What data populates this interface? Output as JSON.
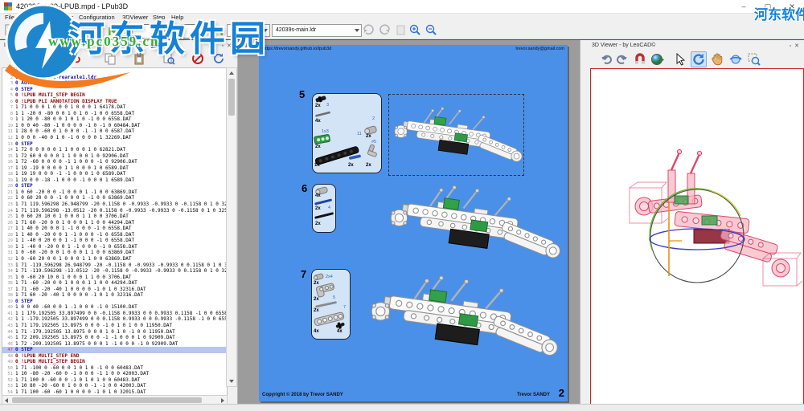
{
  "window": {
    "title": "42039S-1-09-LPUB.mpd - LPub3D",
    "minimize": "–",
    "maximize": "▢",
    "close": "✕"
  },
  "menu": {
    "items": [
      "File",
      "Edit",
      "View",
      "Tools",
      "Configuration",
      "3DViewer",
      "Step",
      "Help"
    ]
  },
  "toolbar": {
    "page_input_value": "3 of 224",
    "page_combo_value": "Page 2",
    "model_combo_value": "42039s-main.ldr"
  },
  "watermark": {
    "site_name": "河东软件园",
    "site_url": "www.pc0359.cn",
    "site_name_corner": "河东软件园"
  },
  "editor": {
    "title": "LDraw File Editor",
    "current_line": 47,
    "lines": [
      [
        1,
        "c",
        "0 rear axle"
      ],
      [
        2,
        "m",
        "0 Name: 42039s-rearaxle1.ldr"
      ],
      [
        3,
        "m",
        "0 Author: Trevor SANDY"
      ],
      [
        4,
        "s",
        "0 STEP"
      ],
      [
        5,
        "l",
        "0 !LPUB MULTI_STEP BEGIN"
      ],
      [
        6,
        "l",
        "0 !LPUB PLI ANNOTATION DISPLAY TRUE"
      ],
      [
        7,
        "p",
        "1 71 0 0 0 1 0 0 0 1 0 0 0 1 64178.DAT"
      ],
      [
        8,
        "p",
        "1 1 -20 0 -80 0 0 1 0 1 0 -1 0 0 6558.DAT"
      ],
      [
        9,
        "p",
        "1 1 20 0 -80 0 0 1 0 1 0 -1 0 0 6558.DAT"
      ],
      [
        10,
        "p",
        "1 0 0 40 -80 -1 0 0 0 0 -1 0 -1 0 60484.DAT"
      ],
      [
        11,
        "p",
        "1 28 0 0 -60 0 1 0 0 0 -1 -1 0 0 6587.DAT"
      ],
      [
        12,
        "p",
        "1 0 0 0 -40 0 1 0 -1 0 0 0 0 1 32269.DAT"
      ],
      [
        13,
        "s",
        "0 STEP"
      ],
      [
        14,
        "p",
        "1 72 0 0 0 0 0 1 1 0 0 0 1 0 62821.DAT"
      ],
      [
        15,
        "p",
        "1 72 60 0 0 0 0 1 1 0 0 0 1 0 92906.DAT"
      ],
      [
        16,
        "p",
        "1 72 -60 0 0 0 0 -1 1 0 0 0 -1 0 92906.DAT"
      ],
      [
        17,
        "p",
        "1 19 -19 0 0 0 0 1 1 0 0 0 1 0 6589.DAT"
      ],
      [
        18,
        "p",
        "1 19 19 0 0 0 -1 -1 0 0 0 1 0 6589.DAT"
      ],
      [
        19,
        "p",
        "1 19 0 0 -18 -1 0 0 0 -1 0 0 0 1 6589.DAT"
      ],
      [
        20,
        "s",
        "0 STEP"
      ],
      [
        21,
        "p",
        "1 0 60 -20 0 0 -1 0 0 0 1 -1 0 0 63869.DAT"
      ],
      [
        22,
        "p",
        "1 0 60 20 0 0 -1 0 0 0 1 -1 0 0 63869.DAT"
      ],
      [
        23,
        "p",
        "1 71 119.596298 26.948799 -20 0.1158 0 -0.9933 -0.9933 0 -0.1158 0 1 0 32524.DAT"
      ],
      [
        24,
        "p",
        "1 71 119.596298 -13.0512 -20 0.1158 0 -0.9933 -0.9933 0 -0.1158 0 1 0 32524.DAT"
      ],
      [
        25,
        "p",
        "1 0 60 20 10 0 1 0 0 0 1 1 0 0 3706.DAT"
      ],
      [
        26,
        "p",
        "1 71 60 -20 0 0 1 0 0 0 1 1 0 0 44294.DAT"
      ],
      [
        27,
        "p",
        "1 1 40 0 20 0 0 1 -1 0 0 0 -1 0 6558.DAT"
      ],
      [
        28,
        "p",
        "1 1 40 0 -20 0 0 1 -1 0 0 0 -1 0 6558.DAT"
      ],
      [
        29,
        "p",
        "1 1 -40 0 20 0 0 1 -1 0 0 0 -1 0 6558.DAT"
      ],
      [
        30,
        "p",
        "1 1 -40 0 -20 0 0 1 -1 0 0 0 -1 0 6558.DAT"
      ],
      [
        31,
        "p",
        "1 0 -60 -20 0 0 1 0 0 0 1 1 0 0 63869.DAT"
      ],
      [
        32,
        "p",
        "1 0 -60 20 0 0 1 0 0 0 1 1 0 0 63869.DAT"
      ],
      [
        33,
        "p",
        "1 71 -119.596298 26.948799 -20 -0.1158 0 -0.9933 -0.9933 0 0.1158 0 1 0 32524.DAT"
      ],
      [
        34,
        "p",
        "1 71 -119.596298 -13.0512 -20 -0.1158 0 -0.9933 -0.9933 0 0.1158 0 1 0 32524.DAT"
      ],
      [
        35,
        "p",
        "1 0 -60 20 10 0 1 0 0 0 1 1 0 0 3706.DAT"
      ],
      [
        36,
        "p",
        "1 71 -60 -20 0 0 1 0 0 0 1 1 0 0 44294.DAT"
      ],
      [
        37,
        "p",
        "1 71 -60 -20 -40 1 0 0 0 0 -1 0 1 0 32316.DAT"
      ],
      [
        38,
        "p",
        "1 71 60 -20 -40 1 0 0 0 0 -1 0 1 0 32316.DAT"
      ],
      [
        39,
        "s",
        "0 STEP"
      ],
      [
        40,
        "p",
        "1 0 0 40 -60 0 0 1 -1 0 0 0 -1 0 15100.DAT"
      ],
      [
        41,
        "p",
        "1 1 179.192505 33.897499 0 0 -0.1158 0.9933 0 0 0.9933 0.1158 -1 0 0 6558.DAT"
      ],
      [
        42,
        "p",
        "1 1 -179.192505 33.897499 0 0 0.1158 0.9933 0 0 0.9933 -0.1158 -1 0 0 6558.DAT"
      ],
      [
        43,
        "p",
        "1 71 179.192505 13.8975 0 0 0 -1 0 1 0 1 0 0 11950.DAT"
      ],
      [
        44,
        "p",
        "1 71 -179.192505 13.8975 0 0 0 1 0 1 0 -1 0 0 11950.DAT"
      ],
      [
        45,
        "p",
        "1 72 209.192505 13.8975 0 0 0 -1 -1 0 0 0 1 0 92909.DAT"
      ],
      [
        46,
        "p",
        "1 72 -209.192505 13.8975 0 0 0 1 -1 0 0 0 -1 0 92909.DAT"
      ],
      [
        47,
        "s",
        "0 STEP"
      ],
      [
        48,
        "l",
        "0 !LPUB MULTI_STEP END"
      ],
      [
        49,
        "l",
        "0 !LPUB MULTI_STEP BEGIN"
      ],
      [
        50,
        "p",
        "1 71 -100 0 -60 0 0 1 0 1 0 -1 0 0 60483.DAT"
      ],
      [
        51,
        "p",
        "1 10 -80 -20 -60 0 -1 0 0 0 -1 1 0 0 42003.DAT"
      ],
      [
        52,
        "p",
        "1 71 100 0 -60 0 0 -1 0 1 0 1 0 0 60483.DAT"
      ],
      [
        53,
        "p",
        "1 10 80 -20 -60 0 1 0 0 0 -1 -1 0 0 42003.DAT"
      ],
      [
        54,
        "p",
        "1 71 100 -60 -60 1 0 0 0 0 -1 0 1 0 32015.DAT"
      ]
    ]
  },
  "page": {
    "header_left": "https://trevorsandy.github.io/lpub3d",
    "header_right": "trevor.sandy@gmail.com",
    "footer_left": "Copyright © 2018 by Trevor SANDY",
    "footer_right": "Trevor SANDY",
    "page_number": "2",
    "steps": [
      {
        "number": "5",
        "parts": [
          {
            "qty": "2x",
            "ann": "3"
          },
          {
            "qty": "4x",
            "ann": ""
          },
          {
            "qty": "2x",
            "ann": "1x3"
          },
          {
            "qty": "2x",
            "ann": "2"
          },
          {
            "qty": "1x",
            "ann": "11"
          },
          {
            "qty": "2x",
            "ann": ""
          },
          {
            "qty": "2x",
            "ann": "#5"
          }
        ]
      },
      {
        "number": "6",
        "parts": [
          {
            "qty": "4x",
            "ann": ""
          },
          {
            "qty": "2x",
            "ann": "4"
          },
          {
            "qty": "2x",
            "ann": ""
          }
        ]
      },
      {
        "number": "7",
        "parts": [
          {
            "qty": "2x",
            "ann": "2x4"
          },
          {
            "qty": "2x",
            "ann": ""
          },
          {
            "qty": "2x",
            "ann": "5"
          },
          {
            "qty": "4x",
            "ann": "7"
          },
          {
            "qty": "4x",
            "ann": ""
          }
        ]
      }
    ]
  },
  "viewer3d": {
    "title": "3D Viewer - by LeoCAD©"
  }
}
